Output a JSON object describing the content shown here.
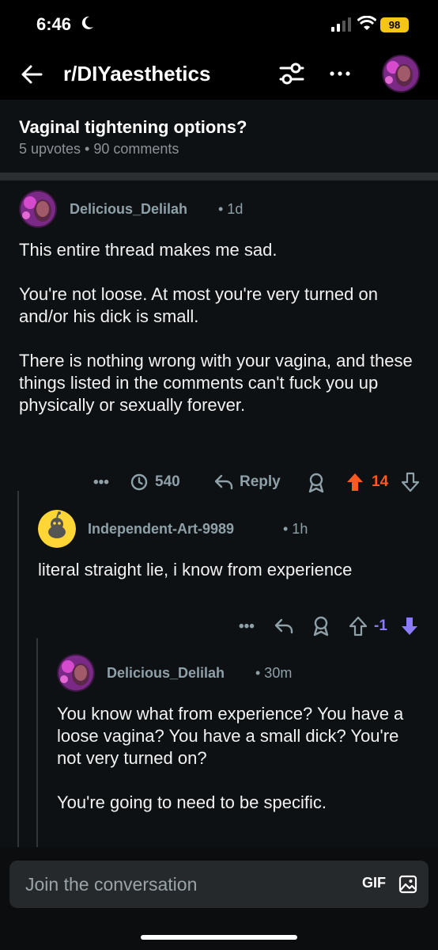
{
  "status_bar": {
    "time": "6:46",
    "battery": "98"
  },
  "header": {
    "subreddit": "r/DIYaesthetics",
    "icons": [
      "back-arrow-icon",
      "filter-icon",
      "more-icon"
    ]
  },
  "post": {
    "title": "Vaginal tightening options?",
    "meta": "5 upvotes • 90 comments"
  },
  "comments": [
    {
      "author": "Delicious_Delilah",
      "time": "• 1d",
      "body": "This entire thread makes me sad.\n\nYou're not loose. At most you're very turned on and/or his dick is small.\n\nThere is nothing wrong with your vagina, and these things listed in the comments can't fuck you up physically or sexually forever.",
      "more_label": "•••",
      "views": "540",
      "reply_label": "Reply",
      "score": "14"
    },
    {
      "author": "Independent-Art-9989",
      "time": "• 1h",
      "body": "literal straight lie, i know from experience",
      "more_label": "•••",
      "score": "-1"
    },
    {
      "author": "Delicious_Delilah",
      "time": "• 30m",
      "body": "You know what from experience? You have a loose vagina? You have a small dick? You're not very turned on?\n\nYou're going to need to be specific."
    }
  ],
  "composer": {
    "placeholder": "Join the conversation",
    "gif_label": "GIF"
  },
  "colors": {
    "upvote": "#ff5a1f",
    "downvote": "#8a7bff",
    "meta_text": "#8ea0a8",
    "background": "#0e1113"
  }
}
